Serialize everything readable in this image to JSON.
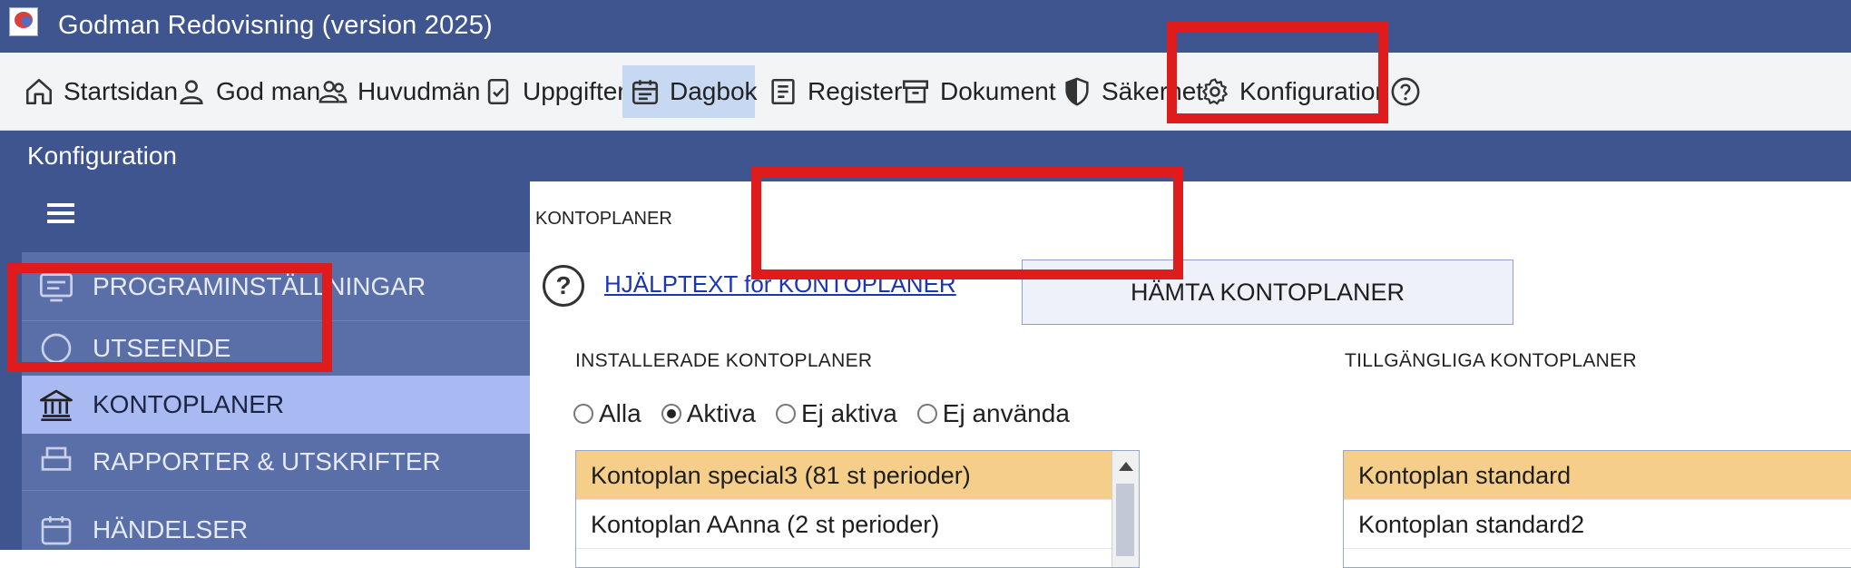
{
  "window": {
    "title": "Godman Redovisning (version 2025)",
    "logo_icon": "app-logo-icon"
  },
  "menubar": {
    "items": [
      {
        "label": "Startsidan",
        "icon": "home-icon"
      },
      {
        "label": "God man",
        "icon": "person-icon"
      },
      {
        "label": "Huvudmän",
        "icon": "people-icon"
      },
      {
        "label": "Uppgifter",
        "icon": "task-icon"
      },
      {
        "label": "Dagbok",
        "icon": "calendar-icon",
        "active": true
      },
      {
        "label": "Register",
        "icon": "register-icon"
      },
      {
        "label": "Dokument",
        "icon": "archive-icon"
      },
      {
        "label": "Säkerhet",
        "icon": "shield-icon"
      },
      {
        "label": "Konfiguration",
        "icon": "gear-icon"
      }
    ],
    "help_icon": "help-icon"
  },
  "panel": {
    "title": "Konfiguration"
  },
  "sidebar": {
    "menu_icon": "hamburger-icon",
    "items": [
      {
        "label": "PROGRAMINSTÄLLNINGAR",
        "icon": "settings-screen-icon"
      },
      {
        "label": "UTSEENDE",
        "icon": "appearance-icon"
      },
      {
        "label": "KONTOPLANER",
        "icon": "bank-icon",
        "selected": true
      },
      {
        "label": "RAPPORTER & UTSKRIFTER",
        "icon": "printer-icon"
      },
      {
        "label": "HÄNDELSER",
        "icon": "calendar-icon"
      }
    ]
  },
  "main": {
    "section_title": "KONTOPLANER",
    "help_link": "HJÄLPTEXT  för  KONTOPLANER",
    "fetch_button": "HÄMTA KONTOPLANER",
    "installed": {
      "label": "INSTALLERADE  KONTOPLANER",
      "filter": {
        "options": [
          "Alla",
          "Aktiva",
          "Ej aktiva",
          "Ej använda"
        ],
        "selected": "Aktiva"
      },
      "rows": [
        "Kontoplan special3 (81 st perioder)",
        "Kontoplan AAnna (2 st perioder)"
      ]
    },
    "available": {
      "label": "TILLGÄNGLIGA  KONTOPLANER",
      "rows": [
        "Kontoplan standard",
        "Kontoplan standard2"
      ]
    }
  },
  "annotations": {
    "color": "#e01b1b"
  }
}
